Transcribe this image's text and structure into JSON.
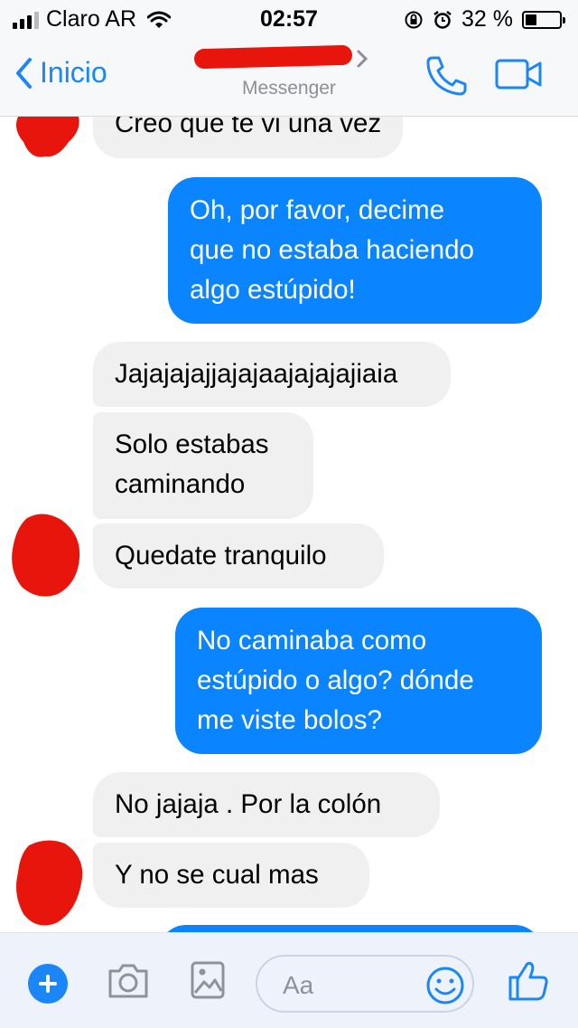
{
  "status_bar": {
    "carrier": "Claro AR",
    "time": "02:57",
    "battery": "32 %",
    "battery_level": 0.32
  },
  "nav": {
    "back_label": "Inicio",
    "subtitle": "Messenger",
    "accent_color": "#1a86f7"
  },
  "messages": [
    {
      "from": "them",
      "text": "Creo que te vi una vez"
    },
    {
      "from": "me",
      "lines": [
        "Oh, por favor, decime",
        "que no estaba haciendo",
        "algo estúpido!"
      ]
    },
    {
      "from": "them",
      "text": "Jajajajajjajajaajajajajiaia"
    },
    {
      "from": "them",
      "lines": [
        "Solo estabas",
        "caminando"
      ]
    },
    {
      "from": "them",
      "text": "Quedate tranquilo"
    },
    {
      "from": "me",
      "lines": [
        "No caminaba como",
        "estúpido o algo? dónde",
        "me viste bolos?"
      ]
    },
    {
      "from": "them",
      "text": "No jajaja . Por la colón"
    },
    {
      "from": "them",
      "text": "Y no se cual mas"
    }
  ],
  "colors": {
    "outgoing_bubble": "#0a84ff",
    "incoming_bubble": "#f1f0f0",
    "redaction": "#e8150d"
  },
  "composer": {
    "placeholder": "Aa",
    "icons": [
      "plus-icon",
      "camera-icon",
      "gallery-icon",
      "emoji-icon",
      "like-icon"
    ]
  }
}
